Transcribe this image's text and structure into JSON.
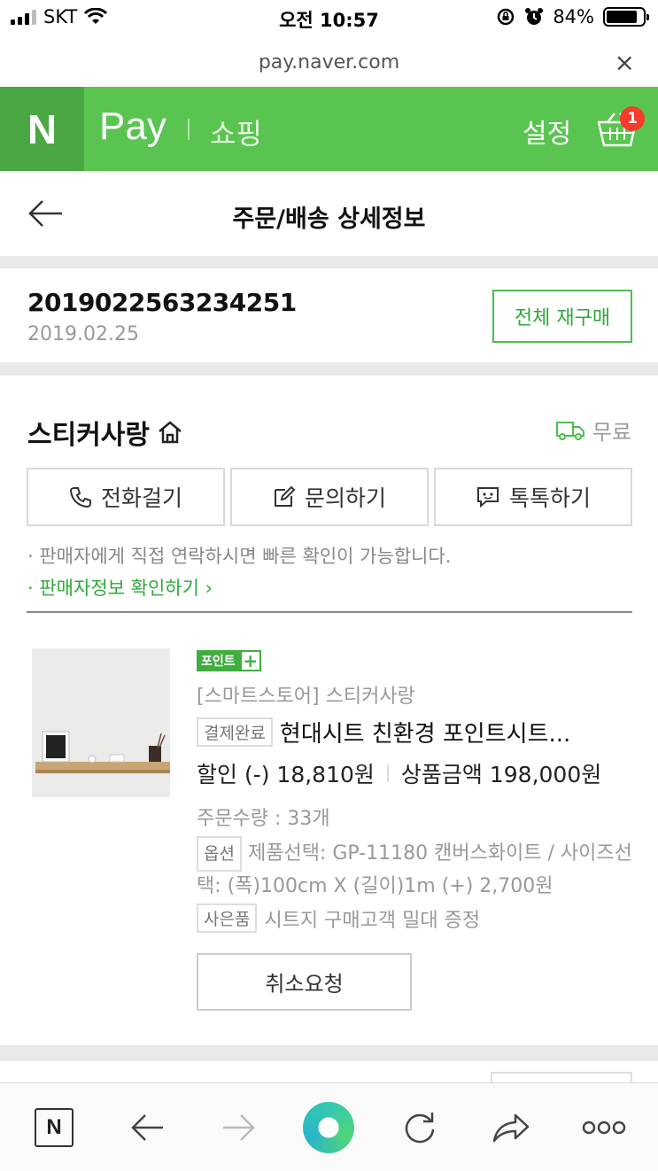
{
  "status_bar": {
    "carrier": "SKT",
    "time": "오전 10:57",
    "battery": "84%",
    "battery_level": 0.84
  },
  "browser": {
    "url": "pay.naver.com",
    "close_glyph": "×"
  },
  "header": {
    "logo": "N",
    "pay": "Pay",
    "shopping": "쇼핑",
    "settings": "설정",
    "cart_count": "1",
    "brand_color": "#5ac451"
  },
  "page": {
    "title": "주문/배송 상세정보"
  },
  "order": {
    "number": "2019022563234251",
    "date": "2019.02.25",
    "rebuy_label": "전체 재구매"
  },
  "seller": {
    "name": "스티커사랑",
    "shipping": "무료",
    "buttons": [
      {
        "label": "전화걸기",
        "icon": "phone-icon"
      },
      {
        "label": "문의하기",
        "icon": "edit-icon"
      },
      {
        "label": "톡톡하기",
        "icon": "chat-icon"
      }
    ],
    "notice": "판매자에게 직접 연락하시면 빠른 확인이 가능합니다.",
    "info_link": "판매자정보 확인하기"
  },
  "product": {
    "badge": "포인트",
    "badge_plus": "+",
    "store": "[스마트스토어] 스티커사랑",
    "status_tag": "결제완료",
    "name": "현대시트 친환경 포인트시트...",
    "discount": "할인 (-) 18,810원",
    "amount": "상품금액 198,000원",
    "quantity": "주문수량 : 33개",
    "option_tag": "옵션",
    "option_text": "제품선택: GP-11180 캔버스화이트 / 사이즈선택: (폭)100cm X (길이)1m (+) 2,700원",
    "gift_tag": "사은품",
    "gift_text": "시트지 구매고객 밀대 증정",
    "cancel_label": "취소요청"
  },
  "toolbar": {
    "home": "N"
  }
}
